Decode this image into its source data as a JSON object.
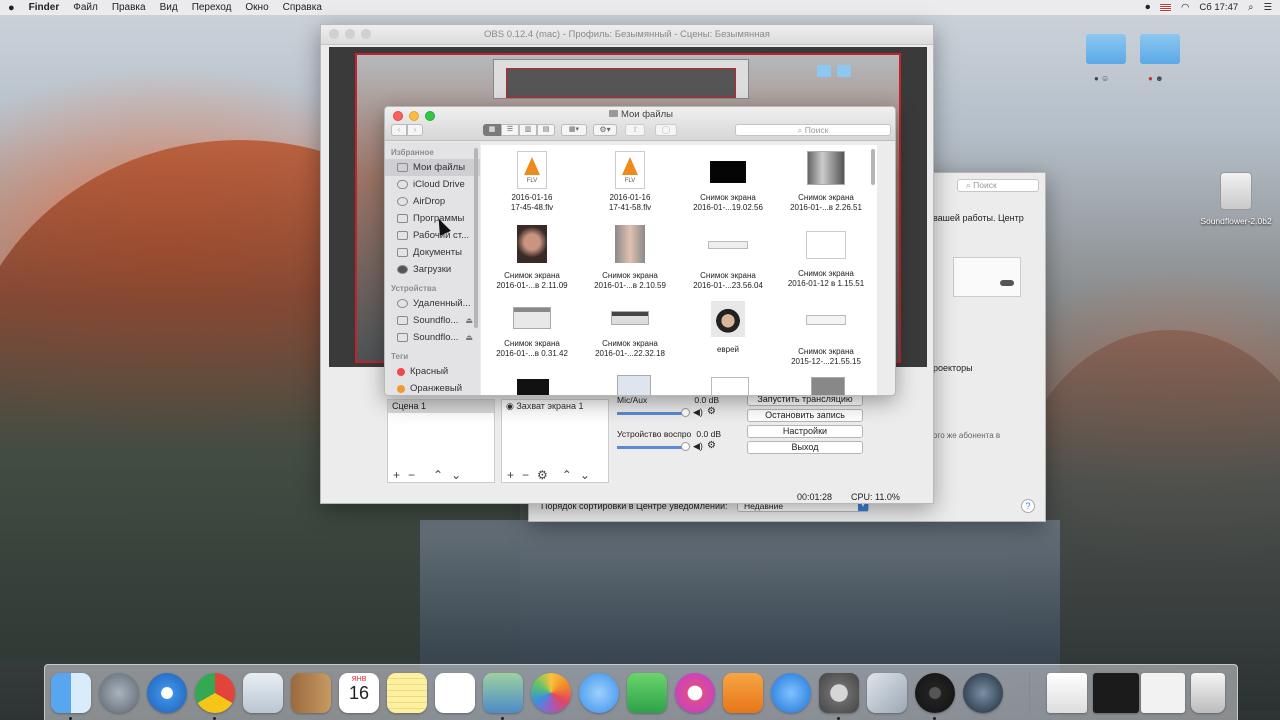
{
  "menubar": {
    "apple_icon": "apple-icon",
    "app_name": "Finder",
    "items": [
      "Файл",
      "Правка",
      "Вид",
      "Переход",
      "Окно",
      "Справка"
    ],
    "clock": "Сб 17:47"
  },
  "desktop": {
    "drive_label": "Soundflower-2.0b2"
  },
  "obs": {
    "title": "OBS 0.12.4 (mac) - Профиль: Безымянный - Сцены: Безымянная",
    "scene_item": "Сцена 1",
    "source_item": "Захват экрана 1",
    "mixer": [
      {
        "label": "Mic/Aux",
        "level": "0.0 dB"
      },
      {
        "label": "Устройство воспро",
        "level": "0.0 dB"
      }
    ],
    "buttons": {
      "start_stream": "Запустить трансляцию",
      "stop_record": "Остановить запись",
      "settings": "Настройки",
      "exit": "Выход"
    },
    "status": {
      "time": "00:01:28",
      "cpu": "CPU: 11.0%"
    }
  },
  "prefs": {
    "search_placeholder": "Поиск",
    "text1": "вашей работы. Центр",
    "text2": "роекторы",
    "text3": "ого же абонента в",
    "sort_label": "Порядок сортировки в Центре уведомлений:",
    "sort_value": "Недавние"
  },
  "finder": {
    "title": "Мои файлы",
    "search_placeholder": "Поиск",
    "sections": {
      "favorites": "Избранное",
      "devices": "Устройства",
      "tags": "Теги"
    },
    "favorites": [
      "Мои файлы",
      "iCloud Drive",
      "AirDrop",
      "Программы",
      "Рабочий ст...",
      "Документы",
      "Загрузки"
    ],
    "devices": [
      "Удаленный...",
      "Soundflo...",
      "Soundflo..."
    ],
    "tags": [
      "Красный",
      "Оранжевый"
    ],
    "files": [
      {
        "line1": "2016-01-16",
        "line2": "17-45-48.flv"
      },
      {
        "line1": "2016-01-16",
        "line2": "17-41-58.flv"
      },
      {
        "line1": "Снимок экрана",
        "line2": "2016-01-...19.02.56"
      },
      {
        "line1": "Снимок экрана",
        "line2": "2016-01-...в 2.26.51"
      },
      {
        "line1": "Снимок экрана",
        "line2": "2016-01-...в 2.11.09"
      },
      {
        "line1": "Снимок экрана",
        "line2": "2016-01-...в 2.10.59"
      },
      {
        "line1": "Снимок экрана",
        "line2": "2016-01-...23.56.04"
      },
      {
        "line1": "Снимок экрана",
        "line2": "2016-01-12 в 1.15.51"
      },
      {
        "line1": "Снимок экрана",
        "line2": "2016-01-...в 0.31.42"
      },
      {
        "line1": "Снимок экрана",
        "line2": "2016-01-...22.32.18"
      },
      {
        "line1": "еврей",
        "line2": ""
      },
      {
        "line1": "Снимок экрана",
        "line2": "2015-12-...21.55.15"
      }
    ]
  },
  "dock": {
    "calendar_month": "ЯНВ",
    "calendar_day": "16"
  }
}
